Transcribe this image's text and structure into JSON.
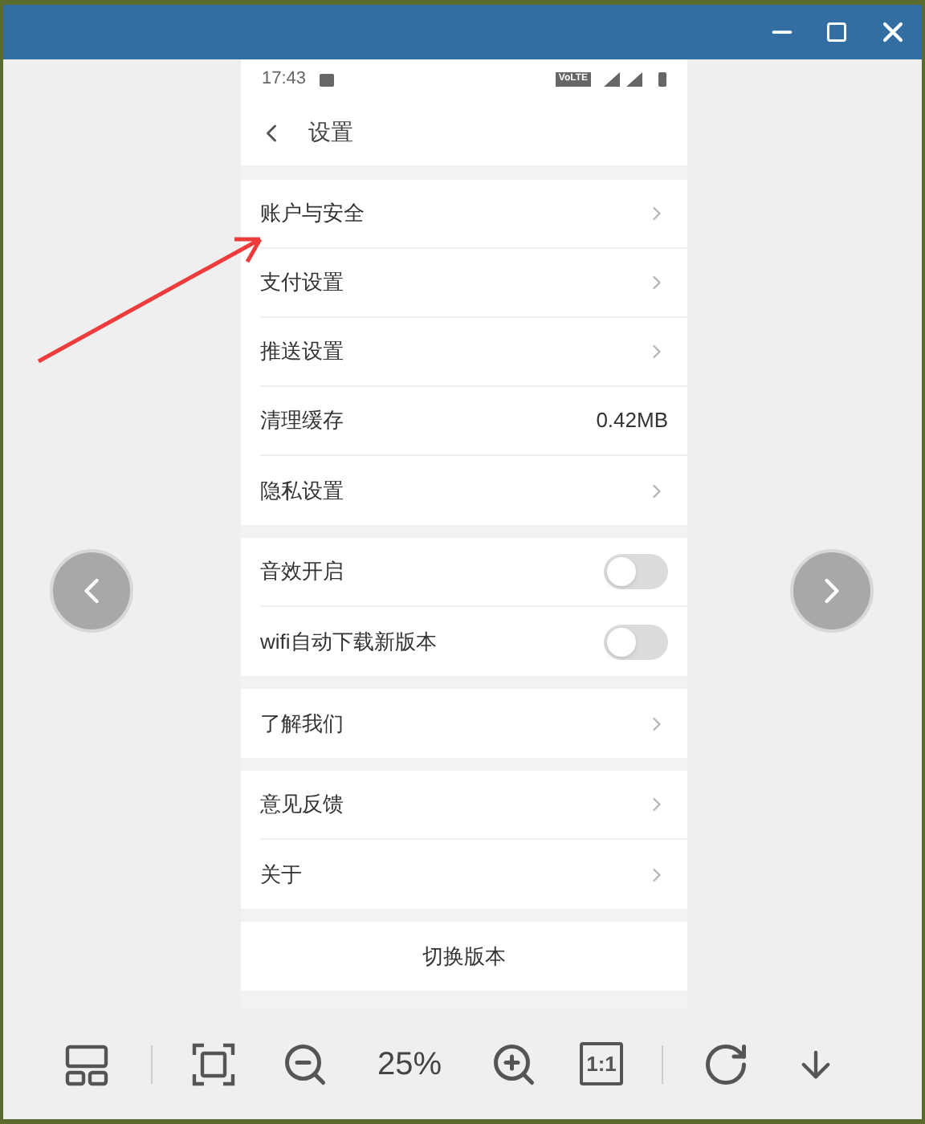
{
  "phone": {
    "status_bar": {
      "time": "17:43",
      "network": "VoLTE"
    },
    "header": {
      "title": "设置"
    },
    "groups": [
      {
        "items": [
          {
            "kind": "link",
            "label": "账户与安全"
          },
          {
            "kind": "link",
            "label": "支付设置"
          },
          {
            "kind": "link",
            "label": "推送设置"
          },
          {
            "kind": "value",
            "label": "清理缓存",
            "value": "0.42MB"
          },
          {
            "kind": "link",
            "label": "隐私设置"
          }
        ]
      },
      {
        "items": [
          {
            "kind": "toggle",
            "label": "音效开启",
            "on": false
          },
          {
            "kind": "toggle",
            "label": "wifi自动下载新版本",
            "on": false
          }
        ]
      },
      {
        "items": [
          {
            "kind": "link",
            "label": "了解我们"
          }
        ]
      },
      {
        "items": [
          {
            "kind": "link",
            "label": "意见反馈"
          },
          {
            "kind": "link",
            "label": "关于"
          }
        ]
      },
      {
        "items": [
          {
            "kind": "center",
            "label": "切换版本"
          }
        ]
      }
    ]
  },
  "toolbar": {
    "zoom": "25%",
    "actual_size": "1:1"
  }
}
